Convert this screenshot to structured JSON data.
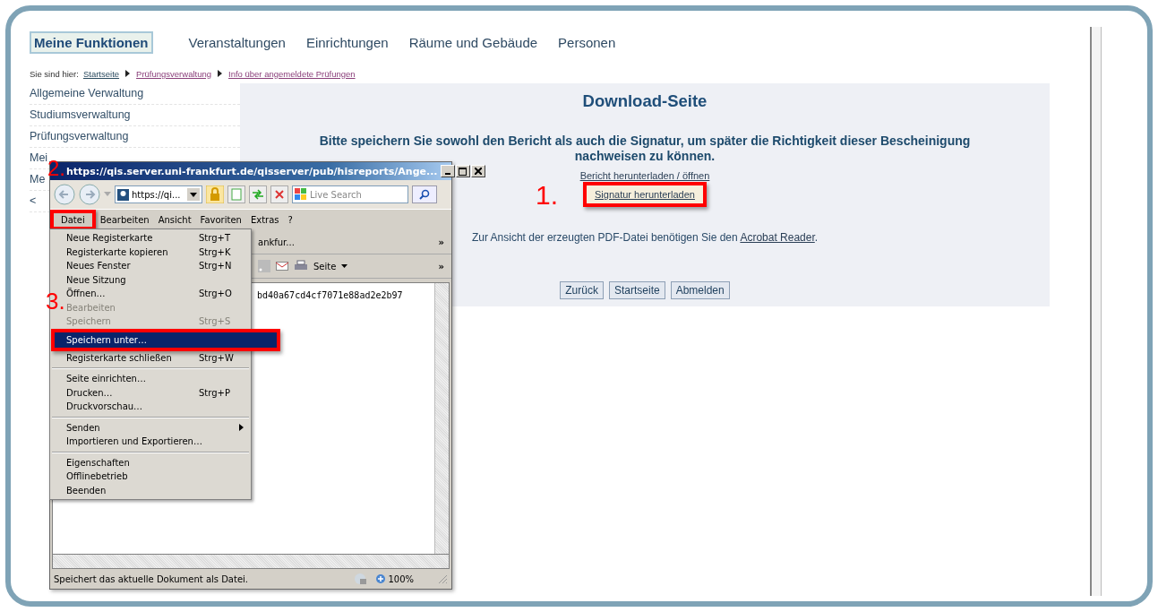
{
  "nav": [
    {
      "label": "Meine Funktionen",
      "selected": true
    },
    {
      "label": "Veranstaltungen",
      "selected": false
    },
    {
      "label": "Einrichtungen",
      "selected": false
    },
    {
      "label": "Räume und Gebäude",
      "selected": false
    },
    {
      "label": "Personen",
      "selected": false
    }
  ],
  "breadcrumb": {
    "label": "Sie sind hier:",
    "items": [
      "Startseite",
      "Prüfungsverwaltung",
      "Info über angemeldete Prüfungen"
    ]
  },
  "sidebar": {
    "items": [
      "Allgemeine Verwaltung",
      "Studiumsverwaltung",
      "Prüfungsverwaltung",
      "Mei",
      "Me",
      "<"
    ]
  },
  "content": {
    "title": "Download-Seite",
    "message": "Bitte speichern Sie sowohl den Bericht als auch die Signatur, um später die Richtigkeit dieser Bescheinigung nachweisen zu können.",
    "links": [
      {
        "label": "Bericht herunterladen / öffnen",
        "highlighted": false
      },
      {
        "label": "Signatur herunterladen",
        "highlighted": true
      }
    ],
    "reader_note": "Zur Ansicht der erzeugten PDF-Datei benötigen Sie den",
    "reader_link": "Acrobat Reader",
    "reader_end": ".",
    "buttons": [
      "Zurück",
      "Startseite",
      "Abmelden"
    ]
  },
  "popup": {
    "title": "https://qis.server.uni-frankfurt.de/qisserver/pub/hisreports/Ange...",
    "address": "https://qi...",
    "search_placeholder": "Live Search",
    "menubar": [
      {
        "label": "Datei",
        "selected": true
      },
      {
        "label": "Bearbeiten",
        "selected": false
      },
      {
        "label": "Ansicht",
        "selected": false
      },
      {
        "label": "Favoriten",
        "selected": false
      },
      {
        "label": "Extras",
        "selected": false
      },
      {
        "label": "?",
        "selected": false
      }
    ],
    "tab_label": "ankfur...",
    "chevron": "»",
    "command": "Seite",
    "page_text": "bd40a67cd4cf7071e88ad2e2b97",
    "status": "Speichert das aktuelle Dokument als Datei.",
    "zoom": "100%"
  },
  "menu": {
    "groups": [
      [
        {
          "label": "Neue Registerkarte",
          "shortcut": "Strg+T",
          "disabled": false,
          "selected": false,
          "submenu": false
        },
        {
          "label": "Registerkarte kopieren",
          "shortcut": "Strg+K",
          "disabled": false,
          "selected": false,
          "submenu": false
        },
        {
          "label": "Neues Fenster",
          "shortcut": "Strg+N",
          "disabled": false,
          "selected": false,
          "submenu": false
        },
        {
          "label": "Neue Sitzung",
          "disabled": false,
          "selected": false,
          "submenu": false
        },
        {
          "label": "Öffnen…",
          "shortcut": "Strg+O",
          "disabled": false,
          "selected": false,
          "submenu": false
        },
        {
          "label": "Bearbeiten",
          "disabled": true,
          "selected": false,
          "submenu": false
        },
        {
          "label": "Speichern",
          "shortcut": "Strg+S",
          "disabled": true,
          "selected": false,
          "submenu": false
        },
        {
          "label": "Speichern unter…",
          "disabled": false,
          "selected": true,
          "submenu": false
        },
        {
          "label": "Registerkarte schließen",
          "shortcut": "Strg+W",
          "disabled": false,
          "selected": false,
          "submenu": false
        }
      ],
      [
        {
          "label": "Seite einrichten…",
          "disabled": false,
          "selected": false,
          "submenu": false
        },
        {
          "label": "Drucken…",
          "shortcut": "Strg+P",
          "disabled": false,
          "selected": false,
          "submenu": false
        },
        {
          "label": "Druckvorschau…",
          "disabled": false,
          "selected": false,
          "submenu": false
        }
      ],
      [
        {
          "label": "Senden",
          "disabled": false,
          "selected": false,
          "submenu": true
        },
        {
          "label": "Importieren und Exportieren…",
          "disabled": false,
          "selected": false,
          "submenu": false
        }
      ],
      [
        {
          "label": "Eigenschaften",
          "disabled": false,
          "selected": false,
          "submenu": false
        },
        {
          "label": "Offlinebetrieb",
          "disabled": false,
          "selected": false,
          "submenu": false
        },
        {
          "label": "Beenden",
          "disabled": false,
          "selected": false,
          "submenu": false
        }
      ]
    ]
  },
  "annotations": [
    {
      "label": "1."
    },
    {
      "label": "2."
    },
    {
      "label": "3."
    }
  ]
}
